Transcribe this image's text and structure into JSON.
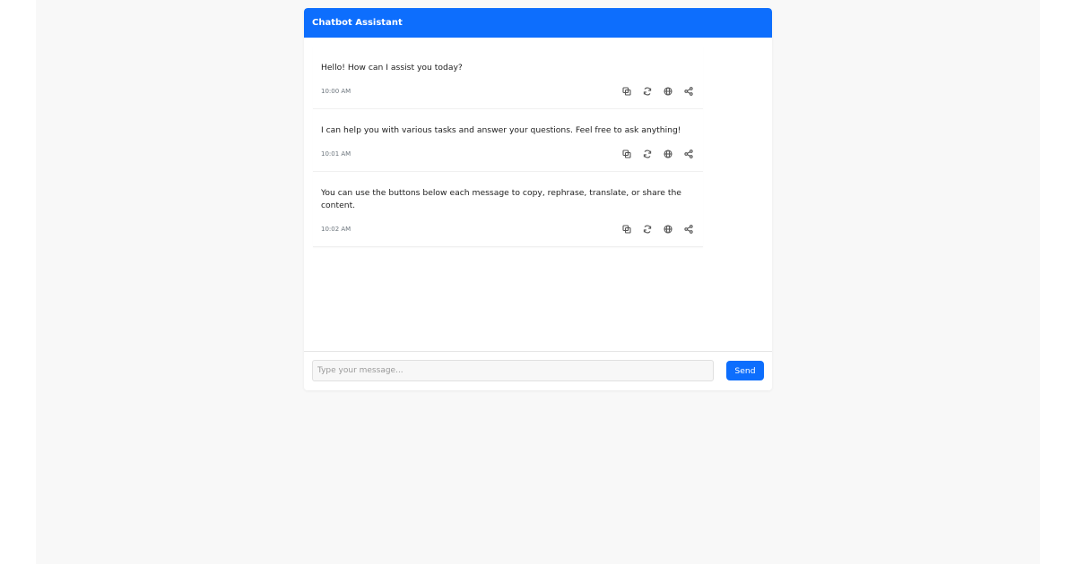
{
  "header": {
    "title": "Chatbot Assistant"
  },
  "messages": [
    {
      "text": "Hello! How can I assist you today?",
      "time": "10:00 AM"
    },
    {
      "text": "I can help you with various tasks and answer your questions. Feel free to ask anything!",
      "time": "10:01 AM"
    },
    {
      "text": "You can use the buttons below each message to copy, rephrase, translate, or share the content.",
      "time": "10:02 AM"
    }
  ],
  "actions": [
    "copy-icon",
    "rephrase-icon",
    "translate-icon",
    "share-icon"
  ],
  "composer": {
    "placeholder": "Type your message...",
    "value": "",
    "send_label": "Send"
  },
  "colors": {
    "accent": "#0d6efd",
    "background": "#f8f8f8"
  }
}
